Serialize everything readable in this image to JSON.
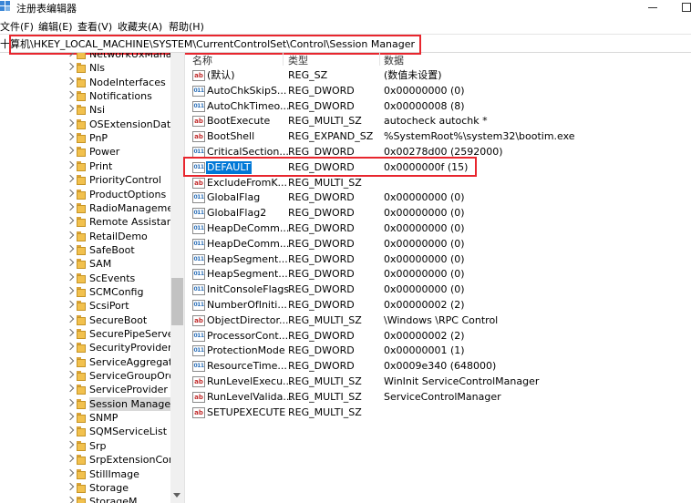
{
  "window": {
    "title": "注册表编辑器"
  },
  "menu": [
    "文件(F)",
    "编辑(E)",
    "查看(V)",
    "收藏夹(A)",
    "帮助(H)"
  ],
  "address": {
    "path": "计算机\\HKEY_LOCAL_MACHINE\\SYSTEM\\CurrentControlSet\\Control\\Session Manager",
    "visible_path": "十算机\\HKEY_LOCAL_MACHINE\\SYSTEM\\CurrentControlSet\\Control\\Session Manager"
  },
  "tree": {
    "items": [
      {
        "label": "NetworkUxManag"
      },
      {
        "label": "Nls"
      },
      {
        "label": "NodeInterfaces"
      },
      {
        "label": "Notifications"
      },
      {
        "label": "Nsi"
      },
      {
        "label": "OSExtensionDatal"
      },
      {
        "label": "PnP"
      },
      {
        "label": "Power"
      },
      {
        "label": "Print"
      },
      {
        "label": "PriorityControl"
      },
      {
        "label": "ProductOptions"
      },
      {
        "label": "RadioManageme"
      },
      {
        "label": "Remote Assistanc"
      },
      {
        "label": "RetailDemo"
      },
      {
        "label": "SafeBoot"
      },
      {
        "label": "SAM"
      },
      {
        "label": "ScEvents"
      },
      {
        "label": "SCMConfig"
      },
      {
        "label": "ScsiPort"
      },
      {
        "label": "SecureBoot"
      },
      {
        "label": "SecurePipeServer"
      },
      {
        "label": "SecurityProviders"
      },
      {
        "label": "ServiceAggregate"
      },
      {
        "label": "ServiceGroupOrd"
      },
      {
        "label": "ServiceProvider"
      },
      {
        "label": "Session Manager",
        "selected": true
      },
      {
        "label": "SNMP"
      },
      {
        "label": "SQMServiceList"
      },
      {
        "label": "Srp"
      },
      {
        "label": "SrpExtensionCon"
      },
      {
        "label": "StillImage"
      },
      {
        "label": "Storage"
      },
      {
        "label": "StorageM"
      }
    ]
  },
  "columns": {
    "name": "名称",
    "type": "类型",
    "data": "数据"
  },
  "values": [
    {
      "name": "(默认)",
      "type": "REG_SZ",
      "data": "(数值未设置)",
      "icon": "string-value-icon"
    },
    {
      "name": "AutoChkSkipS...",
      "type": "REG_DWORD",
      "data": "0x00000000 (0)",
      "icon": "binary-value-icon"
    },
    {
      "name": "AutoChkTimeo...",
      "type": "REG_DWORD",
      "data": "0x00000008 (8)",
      "icon": "binary-value-icon"
    },
    {
      "name": "BootExecute",
      "type": "REG_MULTI_SZ",
      "data": "autocheck autochk *",
      "icon": "string-value-icon"
    },
    {
      "name": "BootShell",
      "type": "REG_EXPAND_SZ",
      "data": "%SystemRoot%\\system32\\bootim.exe",
      "icon": "string-value-icon"
    },
    {
      "name": "CriticalSection...",
      "type": "REG_DWORD",
      "data": "0x00278d00 (2592000)",
      "icon": "binary-value-icon"
    },
    {
      "name": "DEFAULT",
      "type": "REG_DWORD",
      "data": "0x0000000f (15)",
      "icon": "binary-value-icon",
      "selected": true
    },
    {
      "name": "ExcludeFromK...",
      "type": "REG_MULTI_SZ",
      "data": "",
      "icon": "string-value-icon"
    },
    {
      "name": "GlobalFlag",
      "type": "REG_DWORD",
      "data": "0x00000000 (0)",
      "icon": "binary-value-icon"
    },
    {
      "name": "GlobalFlag2",
      "type": "REG_DWORD",
      "data": "0x00000000 (0)",
      "icon": "binary-value-icon"
    },
    {
      "name": "HeapDeComm...",
      "type": "REG_DWORD",
      "data": "0x00000000 (0)",
      "icon": "binary-value-icon"
    },
    {
      "name": "HeapDeComm...",
      "type": "REG_DWORD",
      "data": "0x00000000 (0)",
      "icon": "binary-value-icon"
    },
    {
      "name": "HeapSegment...",
      "type": "REG_DWORD",
      "data": "0x00000000 (0)",
      "icon": "binary-value-icon"
    },
    {
      "name": "HeapSegment...",
      "type": "REG_DWORD",
      "data": "0x00000000 (0)",
      "icon": "binary-value-icon"
    },
    {
      "name": "InitConsoleFlags",
      "type": "REG_DWORD",
      "data": "0x00000000 (0)",
      "icon": "binary-value-icon"
    },
    {
      "name": "NumberOfIniti...",
      "type": "REG_DWORD",
      "data": "0x00000002 (2)",
      "icon": "binary-value-icon"
    },
    {
      "name": "ObjectDirector...",
      "type": "REG_MULTI_SZ",
      "data": "\\Windows \\RPC Control",
      "icon": "string-value-icon"
    },
    {
      "name": "ProcessorCont...",
      "type": "REG_DWORD",
      "data": "0x00000002 (2)",
      "icon": "binary-value-icon"
    },
    {
      "name": "ProtectionMode",
      "type": "REG_DWORD",
      "data": "0x00000001 (1)",
      "icon": "binary-value-icon"
    },
    {
      "name": "ResourceTime...",
      "type": "REG_DWORD",
      "data": "0x0009e340 (648000)",
      "icon": "binary-value-icon"
    },
    {
      "name": "RunLevelExecu...",
      "type": "REG_MULTI_SZ",
      "data": "WinInit ServiceControlManager",
      "icon": "string-value-icon"
    },
    {
      "name": "RunLevelValida...",
      "type": "REG_MULTI_SZ",
      "data": "ServiceControlManager",
      "icon": "string-value-icon"
    },
    {
      "name": "SETUPEXECUTE",
      "type": "REG_MULTI_SZ",
      "data": "",
      "icon": "string-value-icon"
    }
  ],
  "colors": {
    "highlight_border": "#e8262e",
    "selection": "#0078d7"
  }
}
